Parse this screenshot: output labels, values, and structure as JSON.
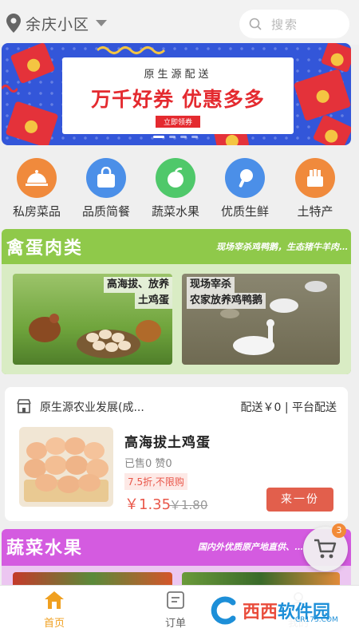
{
  "location": {
    "name": "余庆小区",
    "pin_icon": "location-pin-icon",
    "dropdown_icon": "caret-down-icon"
  },
  "search": {
    "placeholder": "搜索",
    "icon": "search-icon"
  },
  "banner": {
    "subtitle": "原生源配送",
    "headline": "万千好券 优惠多多",
    "button": "立即领券",
    "colors": {
      "background": "#3356d9",
      "accent": "#e42a2f"
    }
  },
  "categories": [
    {
      "label": "私房菜品",
      "icon": "cloche-icon",
      "color": "#f08a3c"
    },
    {
      "label": "品质简餐",
      "icon": "bag-icon",
      "color": "#4b8fe8"
    },
    {
      "label": "蔬菜水果",
      "icon": "apple-icon",
      "color": "#4fc86a"
    },
    {
      "label": "优质生鲜",
      "icon": "drumstick-icon",
      "color": "#4b8fe8"
    },
    {
      "label": "土特产",
      "icon": "basket-icon",
      "color": "#f08a3c"
    }
  ],
  "section_poultry": {
    "title": "禽蛋肉类",
    "slogan": "现场宰杀鸡鸭鹅，生态猪牛羊肉…",
    "color": "#8fc94a",
    "photos": [
      {
        "tag_line1": "高海拔、放养",
        "tag_line2": "土鸡蛋"
      },
      {
        "tag_line1": "现场宰杀",
        "tag_line2": "农家放养鸡鸭鹅"
      }
    ]
  },
  "store_card": {
    "shop_name": "原生源农业发展(成...",
    "shipping": "配送￥0 | 平台配送",
    "product": {
      "name": "高海拔土鸡蛋",
      "stats": "已售0 赞0",
      "discount": "7.5折,不限购",
      "price": "￥1.35",
      "original_price": "￥1.80",
      "buy_button": "来一份"
    }
  },
  "section_veg": {
    "title": "蔬菜水果",
    "slogan": "国内外优质原产地直供、…",
    "color": "#d45be0"
  },
  "cart": {
    "count": "3",
    "icon": "cart-icon"
  },
  "tabbar": {
    "tabs": [
      {
        "label": "首页",
        "icon": "home-icon",
        "active": true
      },
      {
        "label": "订单",
        "icon": "order-icon",
        "active": false
      },
      {
        "label": "我的",
        "icon": "user-icon",
        "active": false
      }
    ],
    "active_color": "#f0a020"
  },
  "watermark": {
    "text_a": "西西",
    "text_b": "软件园",
    "small": "CR173.COM"
  }
}
